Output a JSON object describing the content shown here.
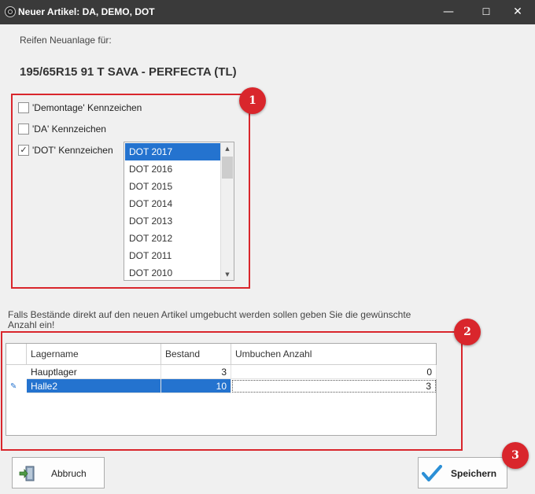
{
  "window": {
    "title": "Neuer Artikel: DA, DEMO, DOT",
    "controls": {
      "minimize": "—",
      "maximize": "☐",
      "close": "✕"
    }
  },
  "subtitle": "Reifen Neuanlage für:",
  "product": "195/65R15 91 T SAVA - PERFECTA (TL)",
  "checkboxes": [
    {
      "label": "'Demontage' Kennzeichen",
      "checked": false
    },
    {
      "label": "'DA' Kennzeichen",
      "checked": false
    },
    {
      "label": "'DOT' Kennzeichen",
      "checked": true
    }
  ],
  "dot_list": {
    "items": [
      "DOT 2017",
      "DOT 2016",
      "DOT 2015",
      "DOT 2014",
      "DOT 2013",
      "DOT 2012",
      "DOT 2011",
      "DOT 2010"
    ],
    "selected": "DOT 2017"
  },
  "info": "Falls Bestände direkt auf den neuen Artikel umgebucht werden sollen geben Sie die gewünschte Anzahl ein!",
  "table": {
    "headers": [
      "Lagername",
      "Bestand",
      "Umbuchen Anzahl"
    ],
    "rows": [
      {
        "name": "Hauptlager",
        "bestand": "3",
        "umbuchen": "0"
      },
      {
        "name": "Halle2",
        "bestand": "10",
        "umbuchen": "3"
      }
    ]
  },
  "buttons": {
    "cancel": "Abbruch",
    "save": "Speichern"
  },
  "badges": [
    "1",
    "2",
    "3"
  ],
  "colors": {
    "accent": "#2473cf",
    "highlight": "#d9262c",
    "titlebar": "#3a3a3a",
    "save_check": "#2b8fd6",
    "cancel_icon": "#4f9a45"
  }
}
